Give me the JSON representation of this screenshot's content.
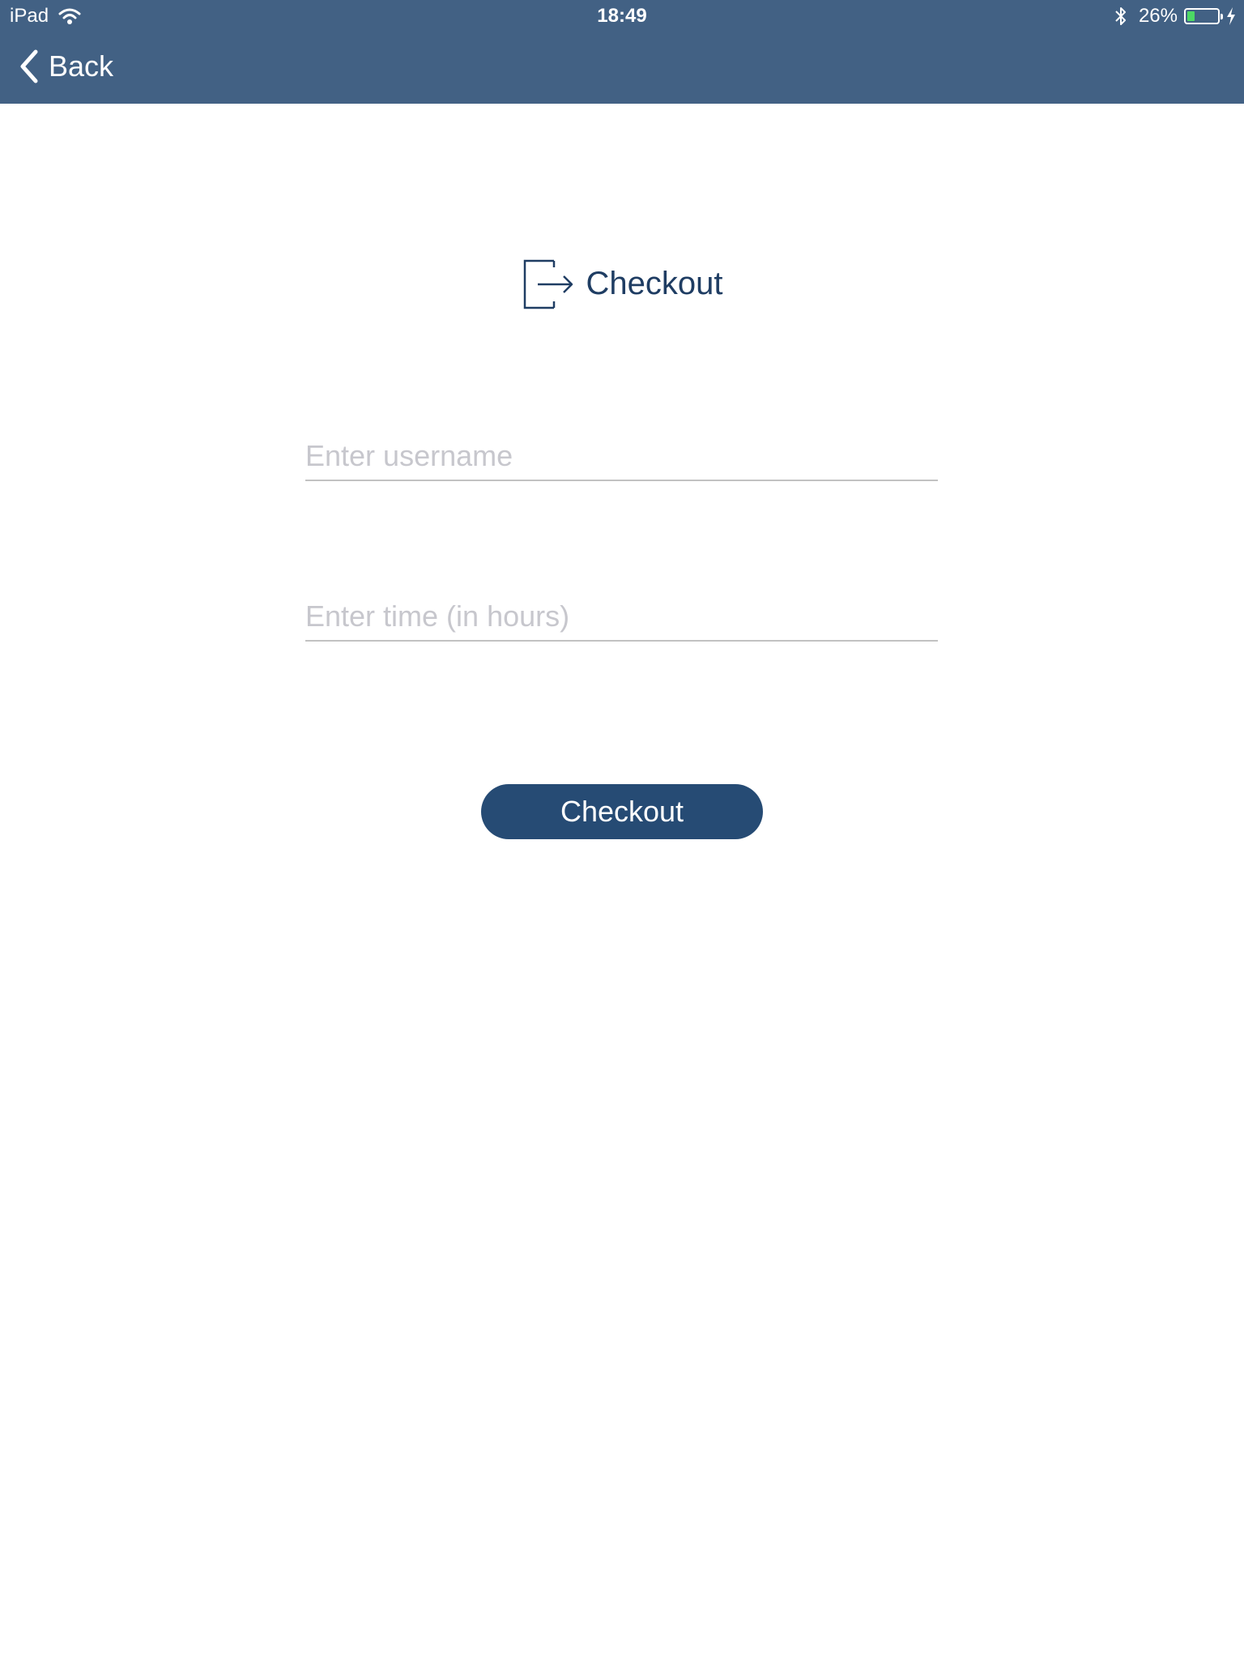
{
  "status_bar": {
    "device": "iPad",
    "time": "18:49",
    "battery_percent": "26%",
    "battery_level": 0.26,
    "icons": [
      "wifi-icon",
      "bluetooth-icon",
      "battery-icon",
      "charging-icon"
    ]
  },
  "nav": {
    "back_label": "Back",
    "bar_color": "#426184"
  },
  "header": {
    "title": "Checkout",
    "icon": "exit-icon"
  },
  "form": {
    "username_placeholder": "Enter username",
    "username_value": "",
    "time_placeholder": "Enter time (in hours)",
    "time_value": ""
  },
  "actions": {
    "checkout_label": "Checkout",
    "button_color": "#264b74"
  }
}
